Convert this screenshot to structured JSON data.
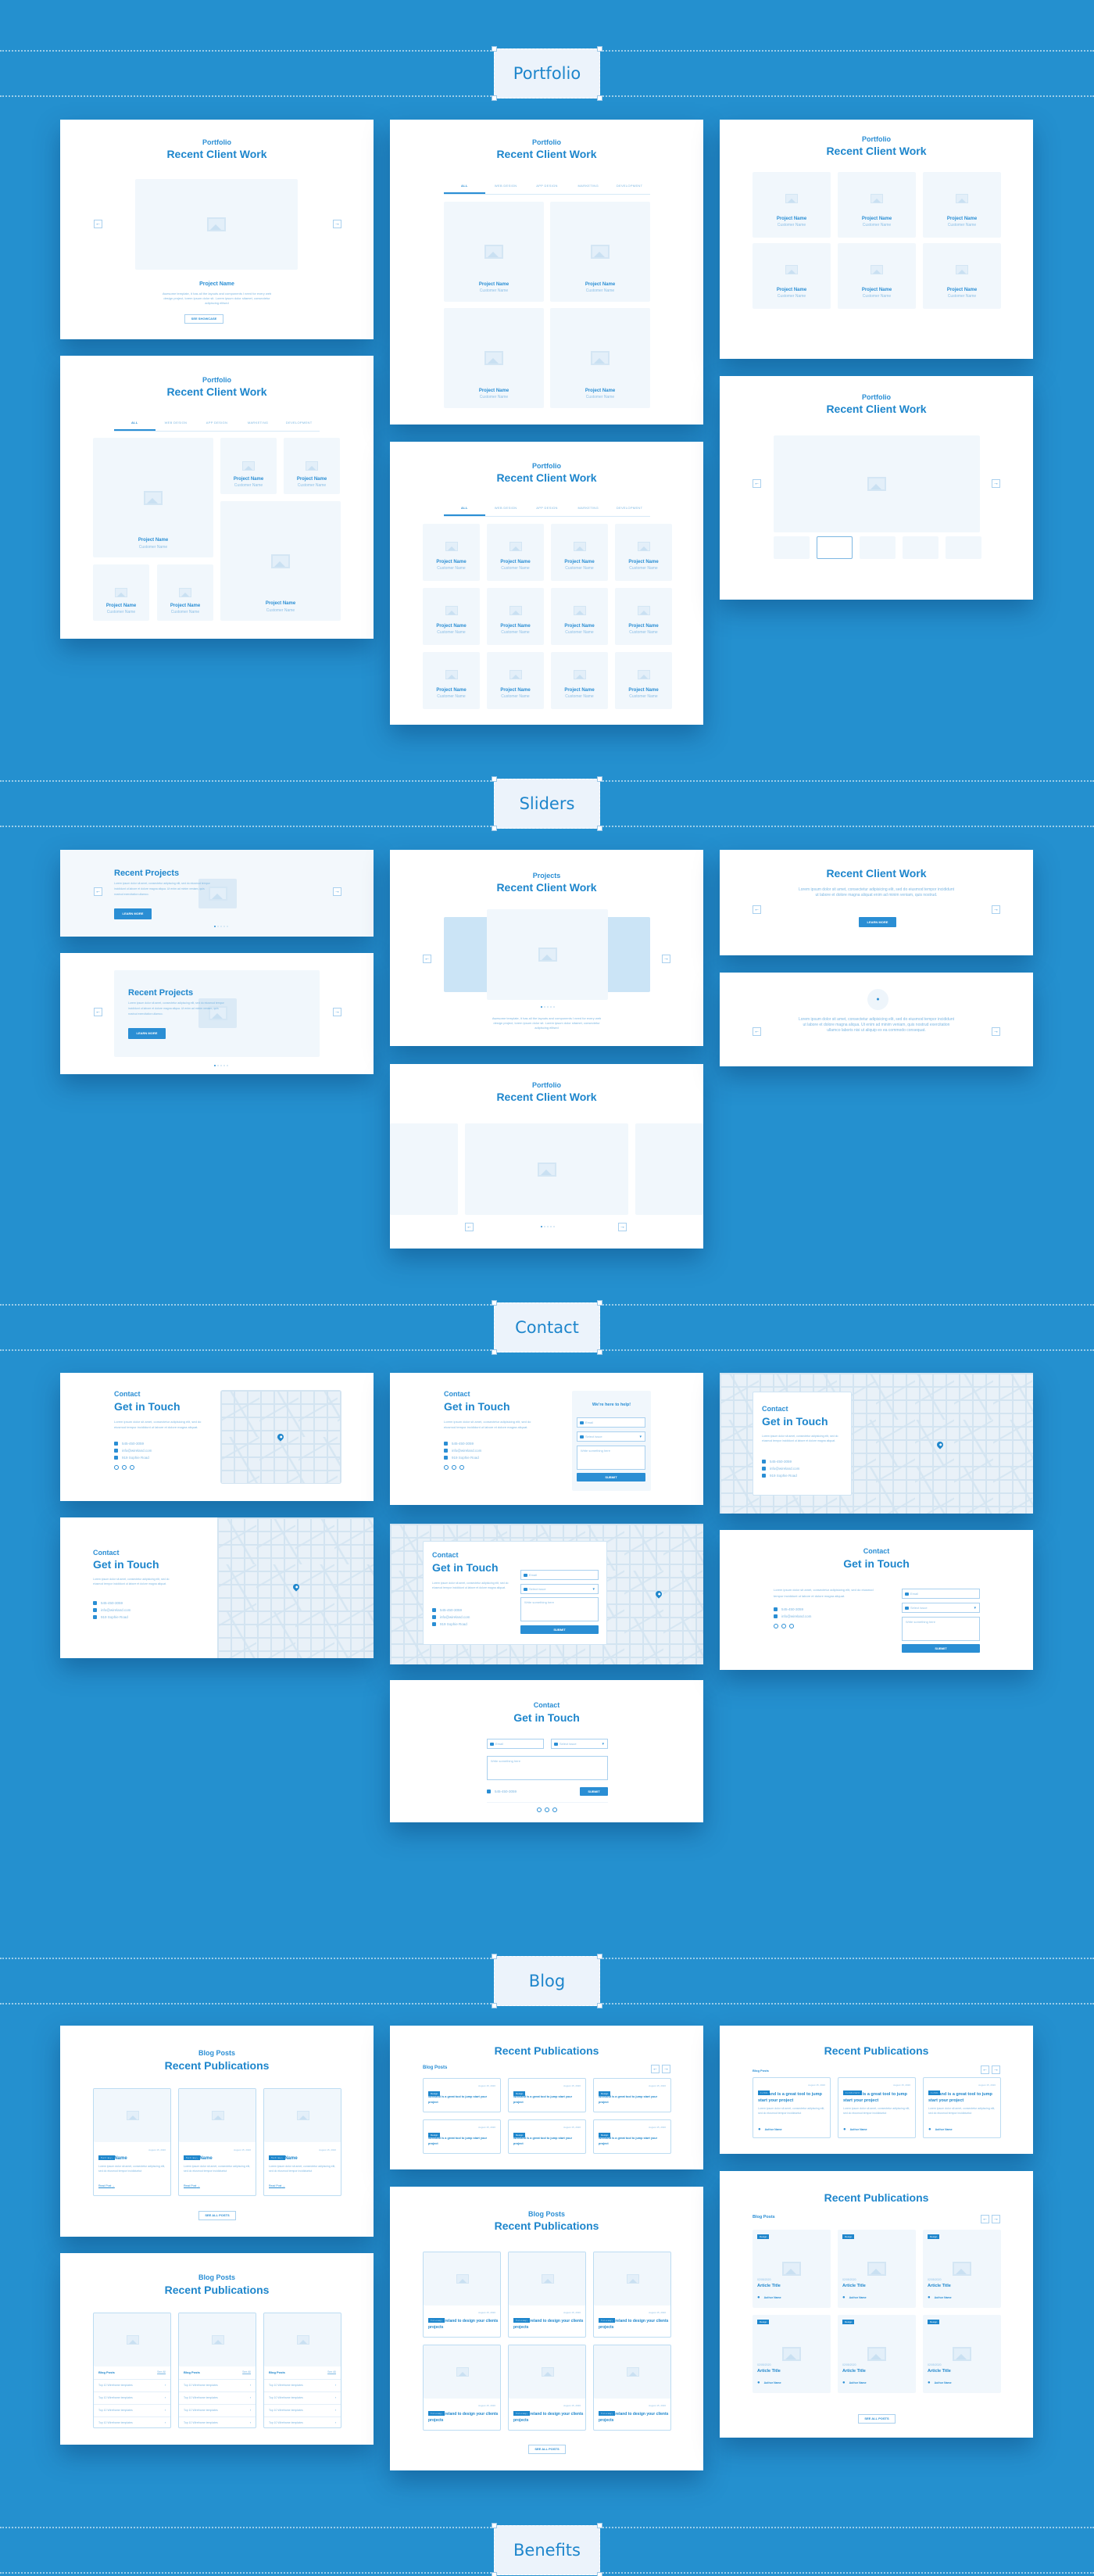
{
  "sections": {
    "portfolio": "Portfolio",
    "sliders": "Sliders",
    "contact": "Contact",
    "blog": "Blog",
    "benefits": "Benefits"
  },
  "portfolio": {
    "eyebrow": "Portfolio",
    "title": "Recent Client Work",
    "project_name": "Project Name",
    "customer_name": "Customer Name",
    "description": "Awesome template, it has all the layouts and components I need for every web design project, lorem ipsum dolor sit. Lorem ipsum dolor sitamet, consectetur adipiscing elitsed",
    "see_showcase": "SEE SHOWCASE",
    "tabs": [
      "ALL",
      "WEB DESIGN",
      "APP DESIGN",
      "MARKETING",
      "DEVELOPMENT"
    ],
    "active_tab": "ALL"
  },
  "sliders": {
    "recent_projects": "Recent Projects",
    "lorem_short": "Lorem ipsum dolor sit amet, consectetur adipiscing elit, sed do eiusmod tempor incididunt ut labore et dolore magna aliqua. Ut enim ad minim veniam, quis nostrud exercitation ullamco.",
    "learn_more": "LEARN MORE",
    "projects_eyebrow": "Projects",
    "portfolio_eyebrow": "Portfolio",
    "title": "Recent Client Work",
    "awesome": "Awesome template, it has all the layouts and components I need for every web design project, lorem ipsum dolor sit. Lorem ipsum dolor sitamet, consectetur adipiscing elitsed",
    "lorem_center": "Lorem ipsum dolor sit amet, consectetur adipisicing elit, sed do eiusmod tempor incididunt ut labore et dolore magna aliquat enim ad minim veniam, quis nostrud.",
    "lorem_testimonial": "Lorem ipsum dolor sit amet, consectetur adipisicing elit, sed do eiusmod tempor incididunt ut labore et dolore magna aliqua. Ut enim ad minim veniam, quis nostrud exercitation ullamco laboris nisi ut aliquip ex ea commodo consequat."
  },
  "contact": {
    "eyebrow": "Contact",
    "title": "Get in Touch",
    "lorem": "Lorem ipsum dolor sit amet, consectetur adipisicing elit, sed do eiusmod tempor incididunt ut labore et dolore magna aliquat.",
    "phone": "545-450-3059",
    "email": "info@wireland.com",
    "address": "919 Sophie Road",
    "help_title": "We're here to help!",
    "email_placeholder": "Email",
    "issue_placeholder": "Select issue",
    "message_placeholder": "Write something here",
    "submit": "SUBMIT"
  },
  "blog": {
    "eyebrow": "Blog Posts",
    "title": "Recent Publications",
    "tag_tech": "Technology",
    "tag_design": "Design",
    "tag_dev": "Development",
    "date": "August 15, 2020",
    "date_short": "02/05/2020",
    "article_name": "Article Name",
    "article_title": "Article Title",
    "excerpt": "Lorem ipsum dolor sit amet, consectetur adipiscing elit, sed do eiusmod tempor incididuntut",
    "read_post": "Read Post",
    "see_all_posts": "SEE ALL POSTS",
    "see_all": "See All",
    "list_item": "Top 10 Wireframe templates",
    "wireland_short": "Wireland is a great tool to jump start your project",
    "using_wireland": "Using Wireland to design your clients projects",
    "author": "Author Name"
  }
}
